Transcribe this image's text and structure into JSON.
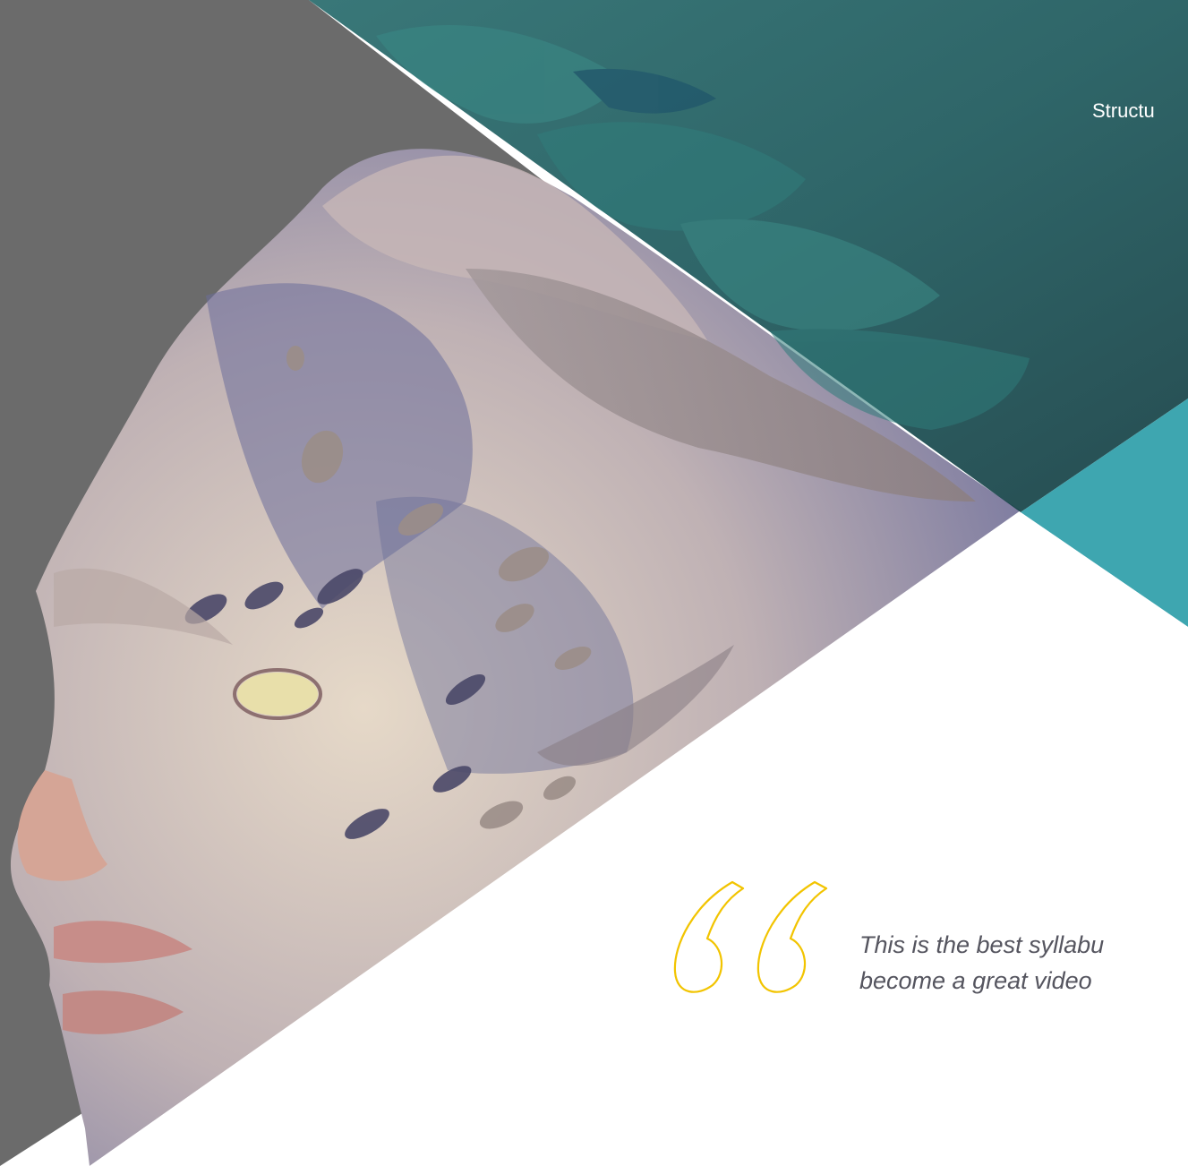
{
  "header": {
    "structure_label": "Structu"
  },
  "testimonial": {
    "line1": "This is the best syllabu",
    "line2": "become a great video"
  },
  "icons": {
    "quote": "quote-open-icon"
  },
  "colors": {
    "background": "#ffffff",
    "left_panel": "#6b6b6b",
    "teal_dark": "#1d4b4f",
    "teal_accent": "#3ea6b0",
    "quote_outline": "#f2c400",
    "quote_text": "#55555f"
  }
}
